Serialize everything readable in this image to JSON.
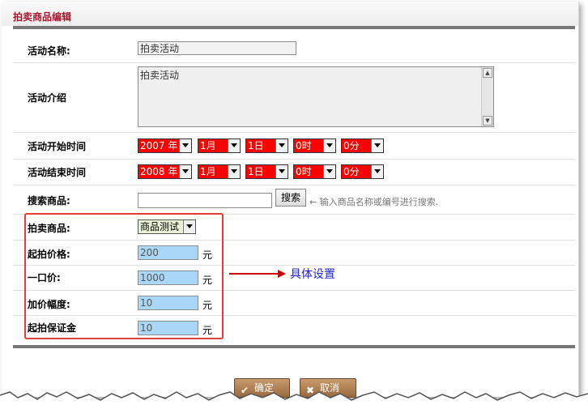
{
  "title": "拍卖商品编辑",
  "fields": {
    "name_label": "活动名称:",
    "name_value": "拍卖活动",
    "intro_label": "活动介绍",
    "intro_value": "拍卖活动",
    "start_label": "活动开始时间",
    "start": {
      "year": "2007 年",
      "month": "1月",
      "day": "1日",
      "hour": "0时",
      "minute": "0分"
    },
    "end_label": "活动结束时间",
    "end": {
      "year": "2008 年",
      "month": "1月",
      "day": "1日",
      "hour": "0时",
      "minute": "0分"
    },
    "search_label": "搜索商品:",
    "search_value": "",
    "search_button": "搜索",
    "search_hint": "← 输入商品名称或编号进行搜索.",
    "item_label": "拍卖商品:",
    "item_value": "商品测试",
    "start_price_label": "起拍价格:",
    "start_price": "200",
    "buyout_label": "一口价:",
    "buyout": "1000",
    "increment_label": "加价幅度:",
    "increment": "10",
    "deposit_label": "起拍保证金",
    "deposit": "10",
    "unit": "元"
  },
  "annotation": "具体设置",
  "buttons": {
    "confirm": "确定",
    "cancel": "取消"
  },
  "colors": {
    "title": "#a6162e",
    "select_bg": "#ff0000",
    "price_bg": "#a9d7f8",
    "annotation": "#2222cc",
    "highlight_box": "#e23c3c"
  },
  "icons": {
    "confirm": "check-icon",
    "cancel": "x-icon"
  }
}
